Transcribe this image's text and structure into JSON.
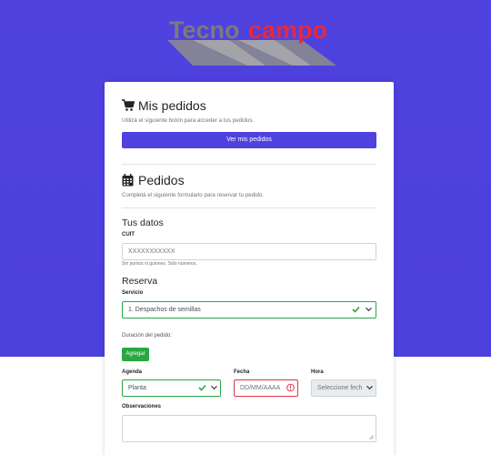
{
  "brand": {
    "logo_part1": "Tecno",
    "logo_part2": "campo",
    "color1": "#7b7b7b",
    "color2": "#e8283a"
  },
  "mis_pedidos": {
    "title": "Mis pedidos",
    "icon": "shopping-cart-icon",
    "subtitle": "Utilizá el siguiente botón para acceder a tus pedidos.",
    "button_label": "Ver mis pedidos"
  },
  "pedidos": {
    "title": "Pedidos",
    "icon": "calendar-icon",
    "subtitle": "Completá el siguiente formulario para reservar tu pedido."
  },
  "tus_datos": {
    "heading": "Tus datos",
    "cuit_label": "CUIT",
    "cuit_placeholder": "XXXXXXXXXXX",
    "cuit_help": "Sin puntos ni guiones. Sólo números."
  },
  "reserva": {
    "heading": "Reserva",
    "servicio_label": "Servicio",
    "servicio_value": "1. Despachos de semillas",
    "duracion_label": "Duración del pedido:",
    "agregar_label": "Agregar",
    "agenda_label": "Agenda",
    "agenda_value": "Planta",
    "fecha_label": "Fecha",
    "fecha_placeholder": "DD/MM/AAAA",
    "hora_label": "Hora",
    "hora_value": "Seleccione fech",
    "observaciones_label": "Observaciones"
  },
  "colors": {
    "primary": "#4f42df",
    "success": "#28a745",
    "danger": "#dc3545"
  }
}
